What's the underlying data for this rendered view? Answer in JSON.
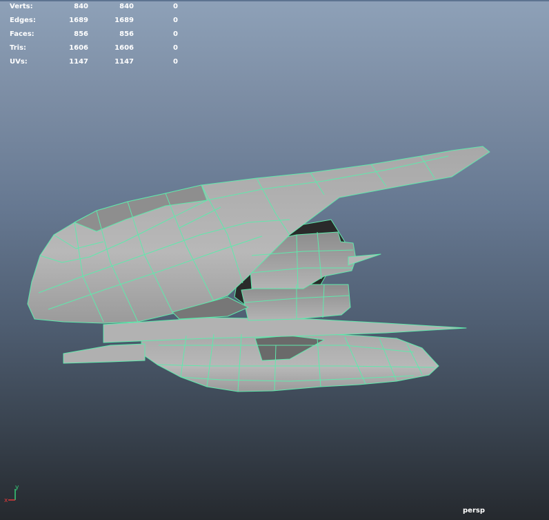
{
  "viewport": {
    "camera_label": "persp",
    "wire_color": "#5fe9ac",
    "background_top": "#8ea1b8",
    "background_bottom": "#25292e"
  },
  "hud": {
    "rows": [
      {
        "label": "Verts:",
        "a": "840",
        "b": "840",
        "c": "0"
      },
      {
        "label": "Edges:",
        "a": "1689",
        "b": "1689",
        "c": "0"
      },
      {
        "label": "Faces:",
        "a": "856",
        "b": "856",
        "c": "0"
      },
      {
        "label": "Tris:",
        "a": "1606",
        "b": "1606",
        "c": "0"
      },
      {
        "label": "UVs:",
        "a": "1147",
        "b": "1147",
        "c": "0"
      }
    ]
  },
  "axis": {
    "x_label": "x",
    "y_label": "y"
  }
}
